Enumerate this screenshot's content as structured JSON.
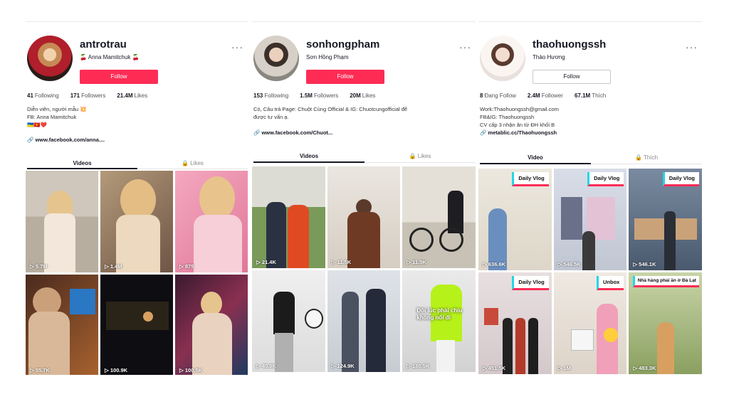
{
  "panels": [
    {
      "username": "antrotrau",
      "display_name": "🍒 Anna Mamitchuk 🍒",
      "follow_label": "Follow",
      "stats": [
        {
          "value": "41",
          "label": "Following"
        },
        {
          "value": "171",
          "label": "Followers"
        },
        {
          "value": "21.4M",
          "label": "Likes"
        }
      ],
      "bio": [
        "Diễn viên, người mẫu 💥",
        "FB: Anna Mamitchuk",
        "🇺🇦🇻🇳❤️"
      ],
      "link": "www.facebook.com/anna....",
      "tabs": [
        "Videos",
        "🔒 Likes"
      ],
      "videos": [
        {
          "views": "▷ 5.7M"
        },
        {
          "views": "▷ 1.4M"
        },
        {
          "views": "▷ 875"
        },
        {
          "views": "▷ 55.7K"
        },
        {
          "views": "▷ 100.9K"
        },
        {
          "views": "▷ 100.5K"
        }
      ]
    },
    {
      "username": "sonhongpham",
      "display_name": "Sơn Hồng Phạm",
      "follow_label": "Follow",
      "stats": [
        {
          "value": "153",
          "label": "Following"
        },
        {
          "value": "1.5M",
          "label": "Followers"
        },
        {
          "value": "20M",
          "label": "Likes"
        }
      ],
      "bio": [
        "Có, Câu trả Page: Chuột Cùng Official & IG: Chuotcungofficial để",
        "được tư vấn ạ."
      ],
      "link": "www.facebook.com/Chuot...",
      "tabs": [
        "Videos",
        "🔒 Likes"
      ],
      "videos": [
        {
          "views": "▷ 21.4K"
        },
        {
          "views": "▷ 11.5K"
        },
        {
          "views": "▷ 11.5K"
        },
        {
          "views": "▷ 45.9K"
        },
        {
          "views": "▷ 124.9K"
        },
        {
          "views": "▷ 180.5K",
          "caption": "Đôi lúc phải chịu khóng nổi đi"
        }
      ]
    },
    {
      "username": "thaohuongssh",
      "display_name": "Thảo Hương",
      "follow_label": "Follow",
      "stats": [
        {
          "value": "8",
          "label": "Đang Follow"
        },
        {
          "value": "2.4M",
          "label": "Follower"
        },
        {
          "value": "67.1M",
          "label": "Thích"
        }
      ],
      "bio": [
        "Work:Thaohuongssh@gmail.com",
        "FB&IG: Thaohuongssh",
        "CV cấp 3 nhận ăn từ ĐH khối B"
      ],
      "link": "metablic.cc/Thaohuongssh",
      "tabs": [
        "Video",
        "🔒 Thích"
      ],
      "videos": [
        {
          "views": "▷ 636.6K",
          "badge": "Daily Vlog"
        },
        {
          "views": "▷ 546.5K",
          "badge": "Daily Vlog"
        },
        {
          "views": "▷ 546.1K",
          "badge": "Daily Vlog"
        },
        {
          "views": "▷ 451.5K",
          "badge": "Daily Vlog"
        },
        {
          "views": "▷ 1M",
          "badge": "Unbox"
        },
        {
          "views": "▷ 483.3K",
          "badge": "Nhà hàng phải ăn ở Đà Lạt"
        }
      ]
    }
  ],
  "colors": {
    "follow_red": "#fe2c55",
    "badge_cyan": "#25d5e8",
    "text_dark": "#161823"
  },
  "icons": {
    "more": "more-horizontal-icon",
    "link": "link-icon",
    "lock": "lock-icon",
    "play": "play-icon"
  }
}
